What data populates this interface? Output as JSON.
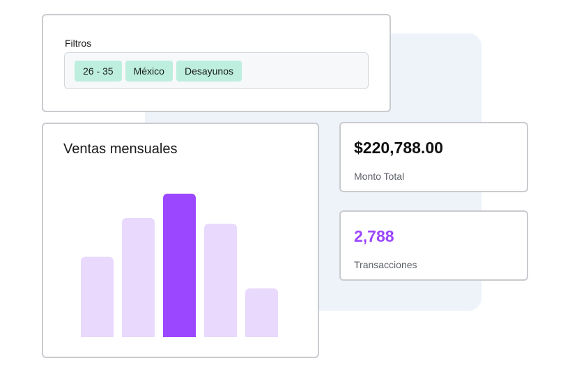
{
  "filters": {
    "label": "Filtros",
    "chips": [
      "26 - 35",
      "México",
      "Desayunos"
    ]
  },
  "chart": {
    "title": "Ventas mensuales"
  },
  "chart_data": {
    "type": "bar",
    "title": "Ventas mensuales",
    "categories": [
      "",
      "",
      "",
      "",
      ""
    ],
    "values": [
      56,
      83,
      100,
      79,
      34
    ],
    "highlight_index": 2,
    "ylim": [
      0,
      100
    ],
    "grid": false,
    "colors": {
      "bar": "#e8d9fd",
      "highlight": "#9b47ff"
    }
  },
  "metrics": [
    {
      "value": "$220,788.00",
      "label": "Monto Total",
      "color": "#111111"
    },
    {
      "value": "2,788",
      "label": "Transacciones",
      "color": "#9b47ff"
    }
  ]
}
